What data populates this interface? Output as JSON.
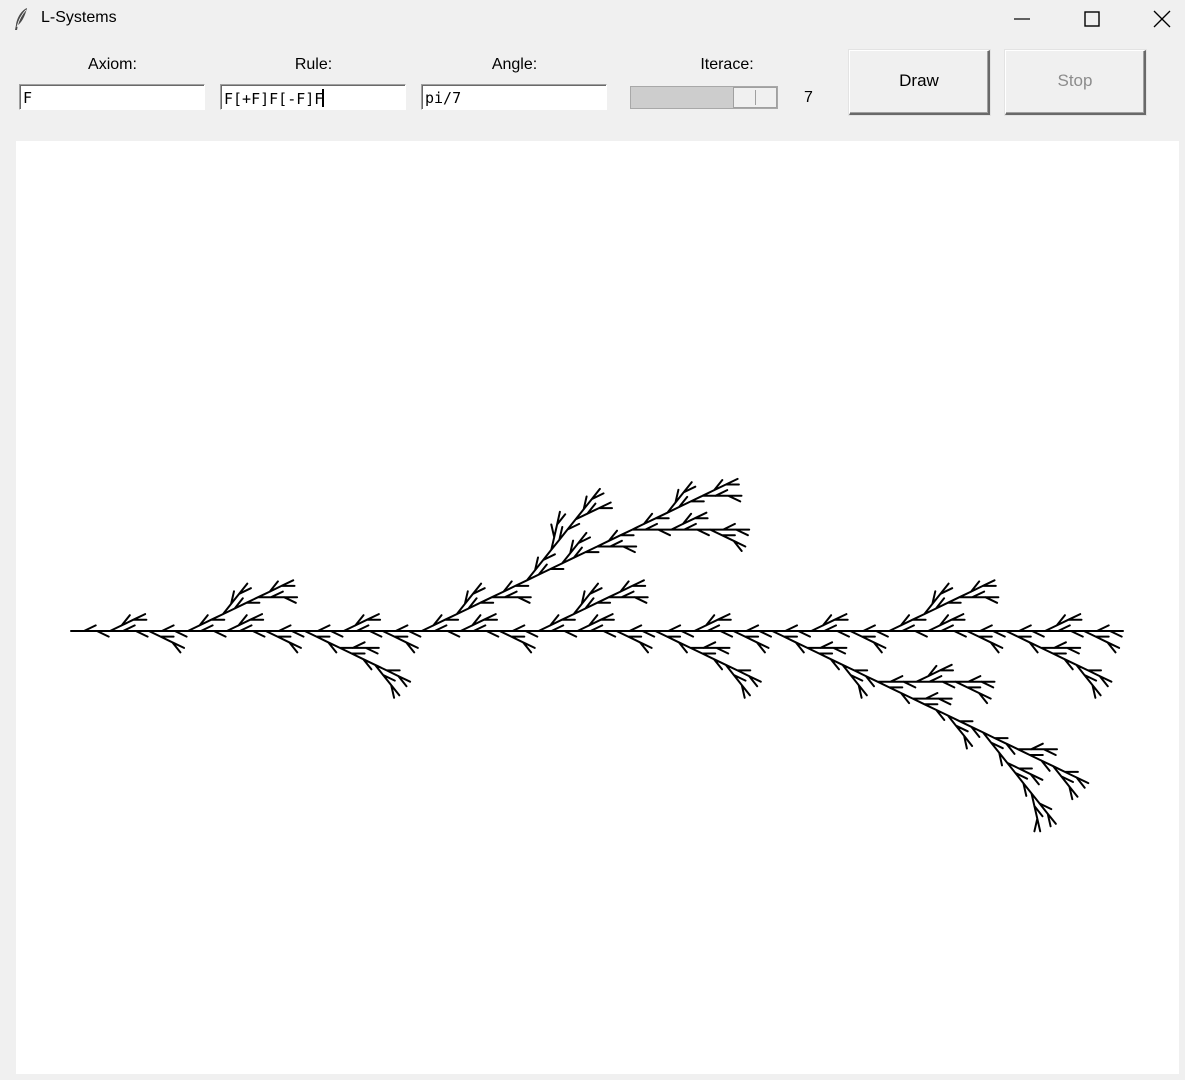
{
  "window": {
    "title": "L-Systems",
    "app_icon": "feather-icon",
    "controls": {
      "minimize_icon": "minimize-icon",
      "maximize_icon": "maximize-icon",
      "close_icon": "close-icon"
    }
  },
  "toolbar": {
    "axiom": {
      "label": "Axiom:",
      "value": "F"
    },
    "rule": {
      "label": "Rule:",
      "value": "F[+F]F[-F]F"
    },
    "angle": {
      "label": "Angle:",
      "value": "pi/7"
    },
    "iterations": {
      "label": "Iterace:",
      "value": "7",
      "slider_fraction": 0.75
    },
    "draw_label": "Draw",
    "stop_label": "Stop",
    "stop_disabled": true
  },
  "canvas": {
    "background": "#ffffff",
    "stroke_color": "#000000",
    "drawing": "L-system plant from rule F[+F]F[-F]F at angle pi/7"
  }
}
